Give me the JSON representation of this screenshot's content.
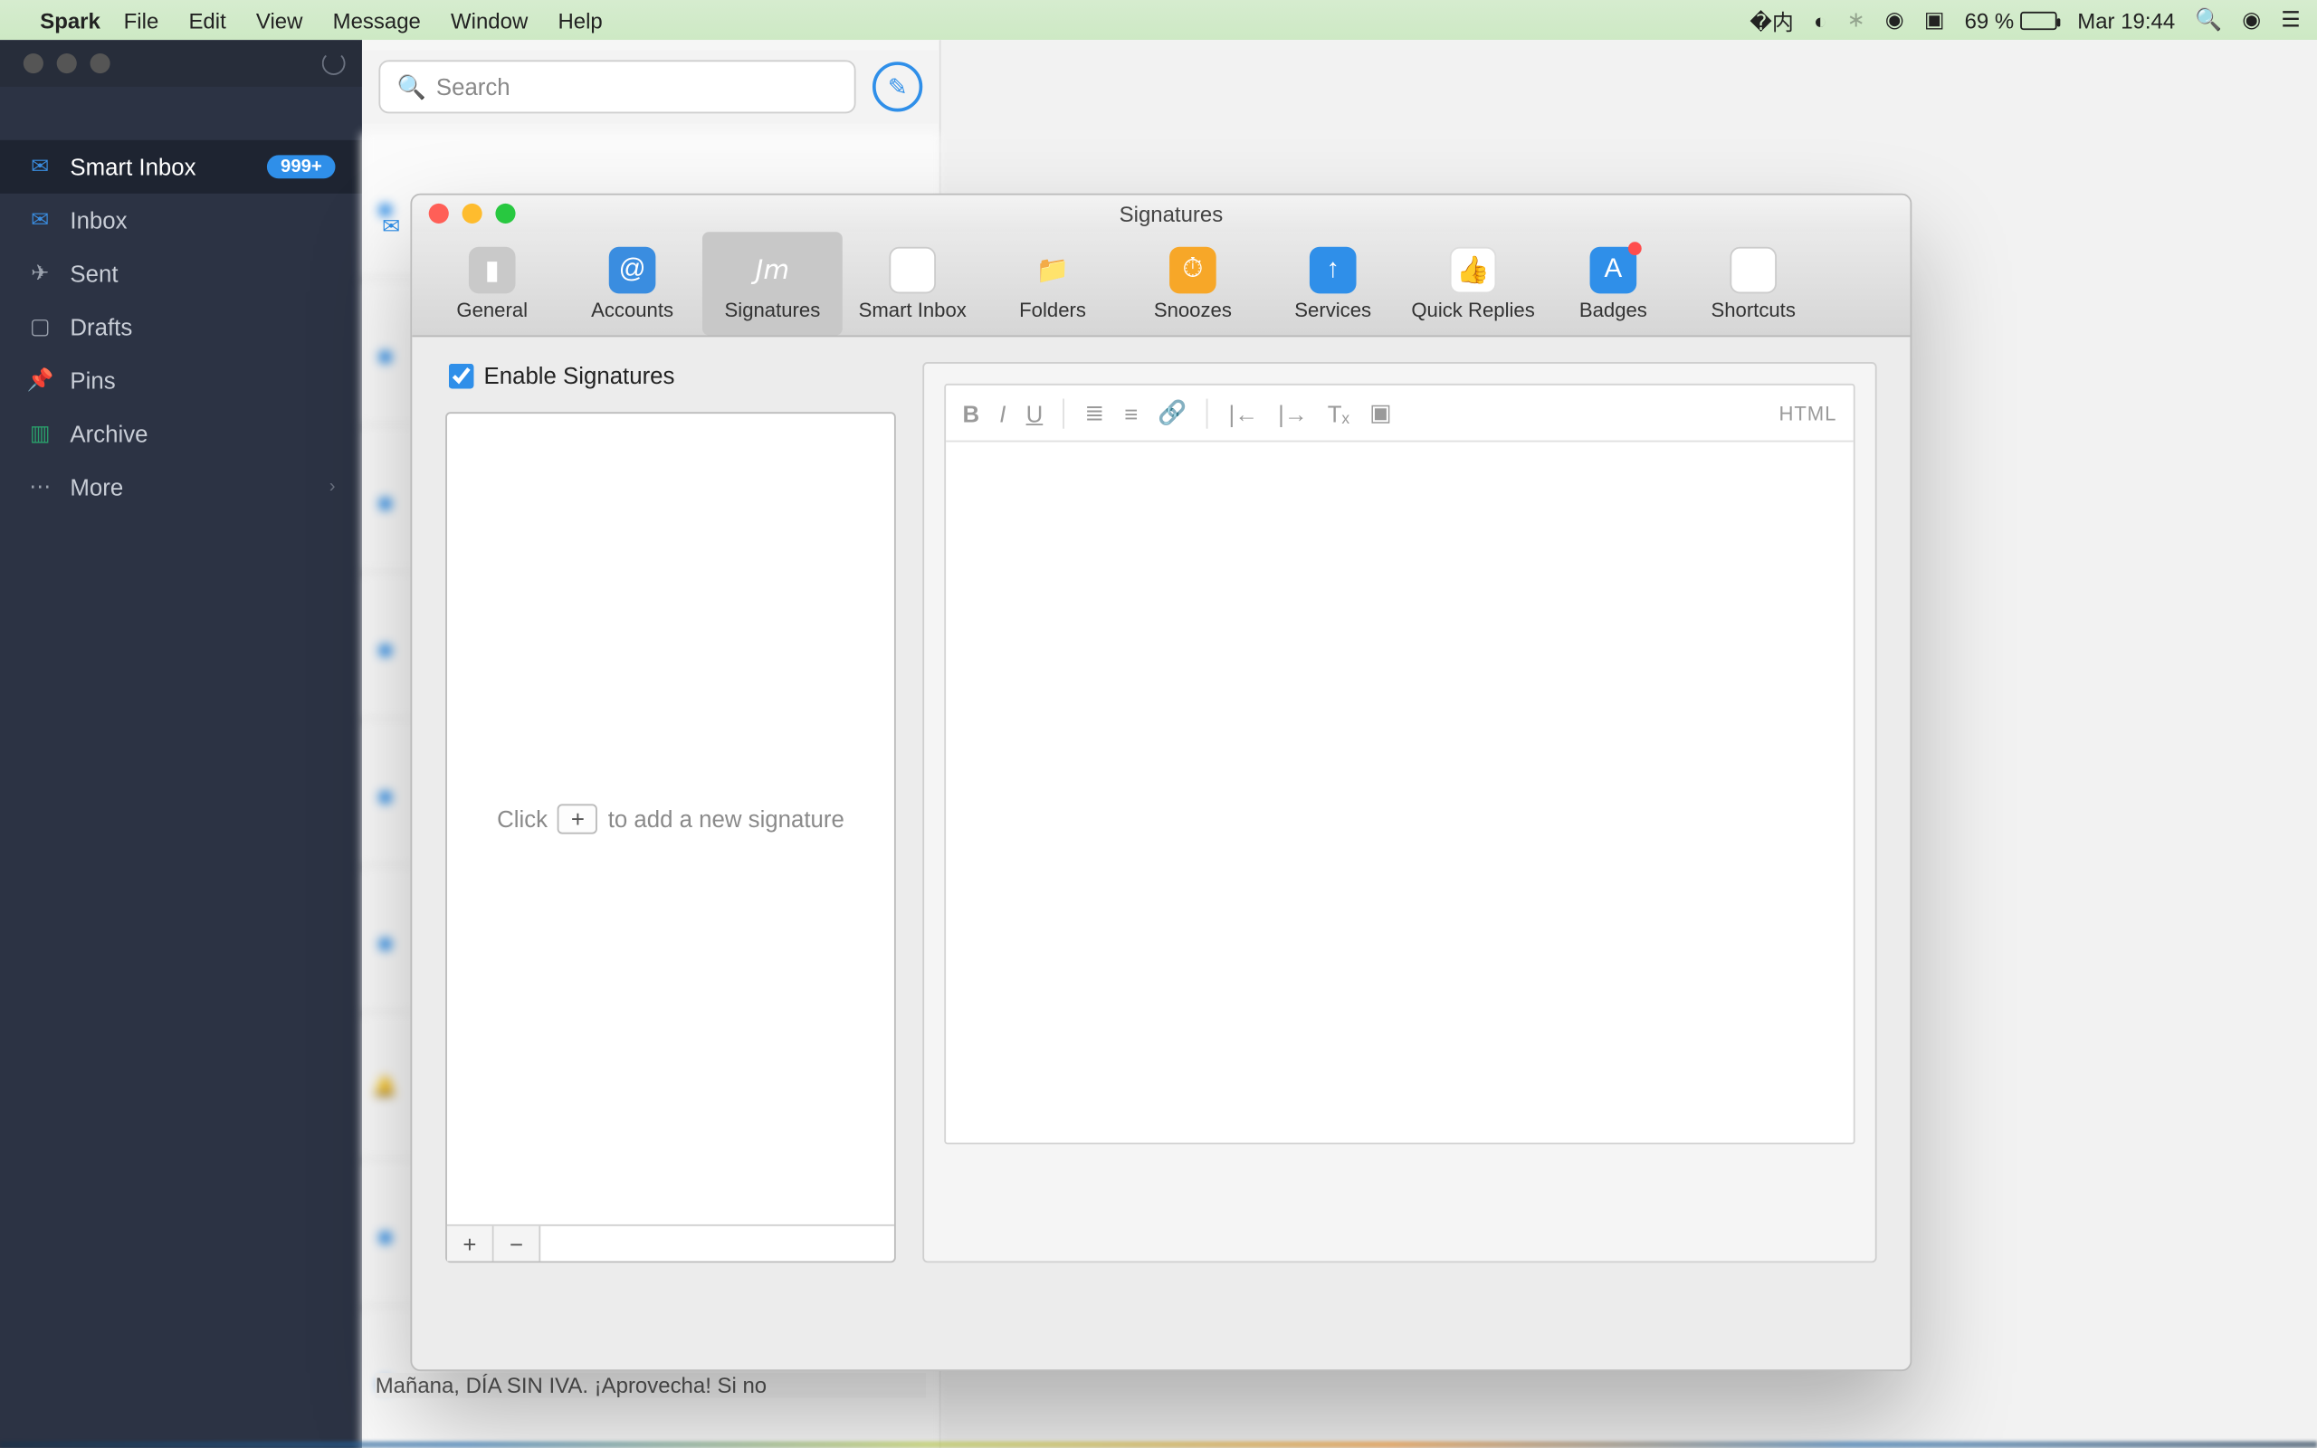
{
  "menubar": {
    "app": "Spark",
    "items": [
      "File",
      "Edit",
      "View",
      "Message",
      "Window",
      "Help"
    ],
    "battery": "69 %",
    "clock": "Mar 19:44"
  },
  "sidebar": {
    "items": [
      {
        "label": "Smart Inbox",
        "badge": "999+"
      },
      {
        "label": "Inbox"
      },
      {
        "label": "Sent"
      },
      {
        "label": "Drafts"
      },
      {
        "label": "Pins"
      },
      {
        "label": "Archive"
      },
      {
        "label": "More"
      }
    ]
  },
  "search": {
    "placeholder": "Search"
  },
  "visible_snippet": "Mañana, DÍA SIN IVA. ¡Aprovecha! Si no",
  "prefs": {
    "title": "Signatures",
    "tabs": [
      "General",
      "Accounts",
      "Signatures",
      "Smart Inbox",
      "Folders",
      "Snoozes",
      "Services",
      "Quick Replies",
      "Badges",
      "Shortcuts"
    ],
    "enable_label": "Enable Signatures",
    "enable_checked": true,
    "empty_pre": "Click",
    "empty_plus": "+",
    "empty_post": "to add a new signature",
    "editor": {
      "html_label": "HTML"
    },
    "footer": {
      "add": "+",
      "remove": "−"
    }
  }
}
